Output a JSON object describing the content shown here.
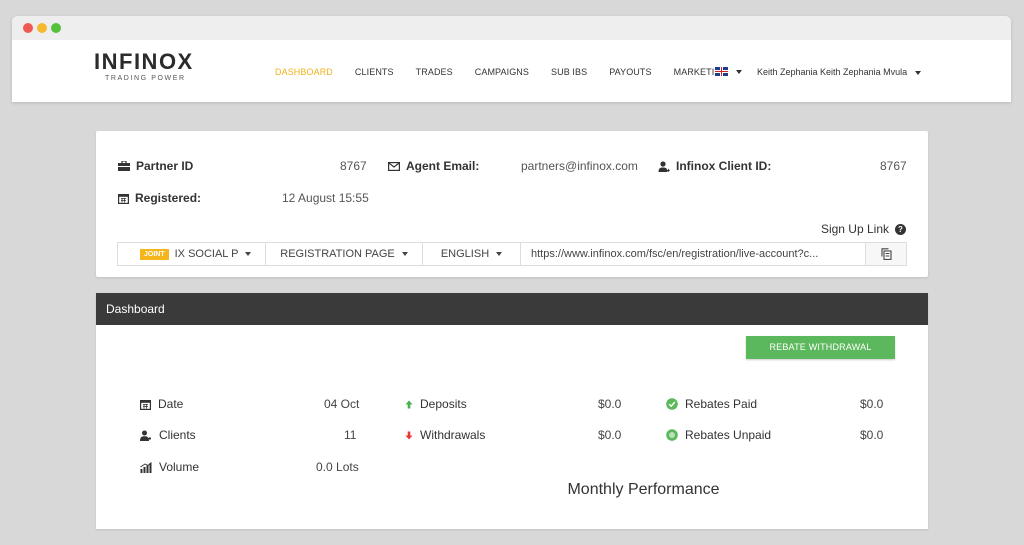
{
  "brand": {
    "name": "INFINOX",
    "tagline": "TRADING POWER"
  },
  "nav": {
    "items": [
      "DASHBOARD",
      "CLIENTS",
      "TRADES",
      "CAMPAIGNS",
      "SUB IBS",
      "PAYOUTS",
      "MARKETING"
    ],
    "active": "DASHBOARD",
    "user_name": "Keith Zephania Keith Zephania Mvula"
  },
  "info": {
    "partner_id_label": "Partner ID",
    "partner_id_value": "8767",
    "agent_email_label": "Agent Email:",
    "agent_email_value": "partners@infinox.com",
    "client_id_label": "Infinox Client ID:",
    "client_id_value": "8767",
    "registered_label": "Registered:",
    "registered_value": "12 August 15:55",
    "signup_link_label": "Sign Up Link",
    "help_glyph": "?"
  },
  "linkbar": {
    "badge": "JOINT",
    "account_type": "IX SOCIAL P",
    "page": "REGISTRATION PAGE",
    "language": "ENGLISH",
    "url": "https://www.infinox.com/fsc/en/registration/live-account?c..."
  },
  "dashboard": {
    "title": "Dashboard",
    "rebate_button": "REBATE WITHDRAWAL",
    "stats": {
      "date_label": "Date",
      "date_value": "04 Oct",
      "clients_label": "Clients",
      "clients_value": "11",
      "volume_label": "Volume",
      "volume_value": "0.0 Lots",
      "deposits_label": "Deposits",
      "deposits_value": "$0.0",
      "withdrawals_label": "Withdrawals",
      "withdrawals_value": "$0.0",
      "rebates_paid_label": "Rebates Paid",
      "rebates_paid_value": "$0.0",
      "rebates_unpaid_label": "Rebates Unpaid",
      "rebates_unpaid_value": "$0.0"
    },
    "performance_title": "Monthly Performance"
  },
  "colors": {
    "accent": "#f0b31e",
    "success": "#5cb85c",
    "header_dark": "#3a3a3a",
    "deposit_up": "#4caf50",
    "withdraw_down": "#e53935"
  },
  "icons": {
    "partner": "briefcase-icon",
    "email": "envelope-icon",
    "client": "user-icon",
    "registered": "calendar-icon",
    "copy": "copy-icon",
    "date": "calendar-icon",
    "clients": "users-icon",
    "volume": "bar-chart-icon",
    "deposits": "arrow-up-icon",
    "withdrawals": "arrow-down-icon",
    "rebates_paid": "check-circle-icon",
    "rebates_unpaid": "circle-icon"
  }
}
